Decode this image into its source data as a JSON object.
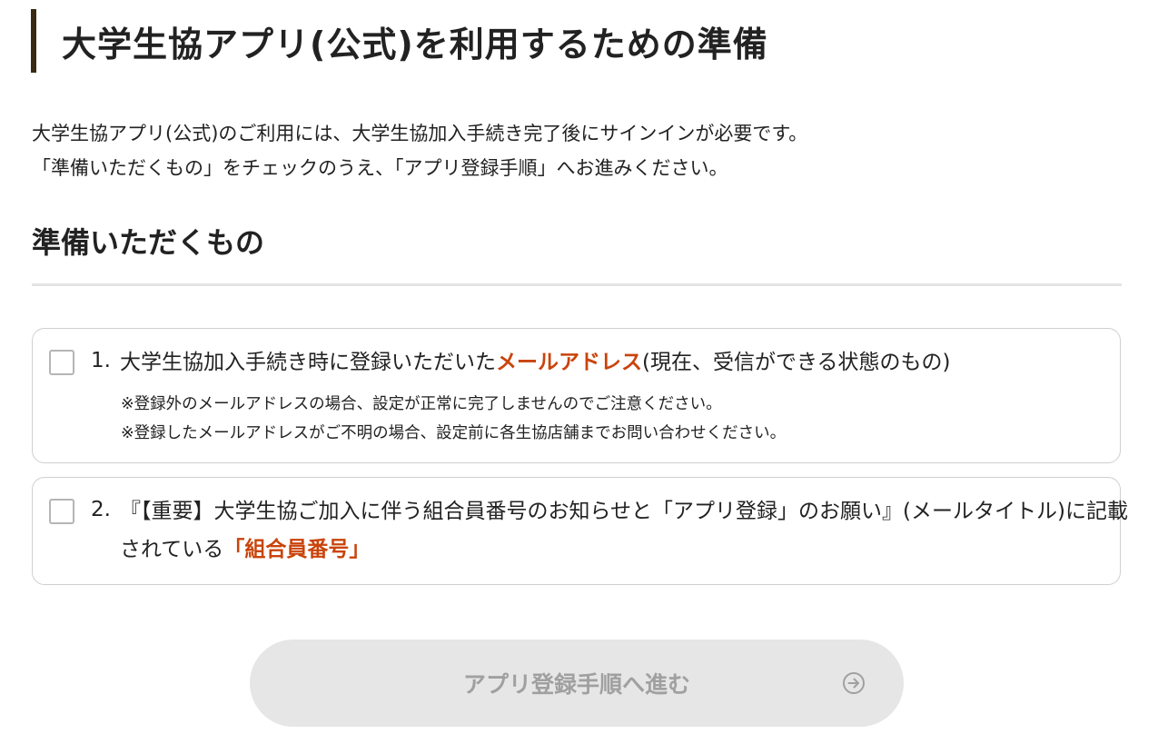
{
  "header": {
    "title": "大学生協アプリ(公式)を利用するための準備"
  },
  "intro": {
    "line1": "大学生協アプリ(公式)のご利用には、大学生協加入手続き完了後にサインインが必要です。",
    "line2": "「準備いただくもの」をチェックのうえ、「アプリ登録手順」へお進みください。"
  },
  "section": {
    "title": "準備いただくもの"
  },
  "items": [
    {
      "number": "1.",
      "text_before": "大学生協加入手続き時に登録いただいた",
      "highlight": "メールアドレス",
      "text_after": "(現在、受信ができる状態のもの)",
      "notes": [
        "※登録外のメールアドレスの場合、設定が正常に完了しませんのでご注意ください。",
        "※登録したメールアドレスがご不明の場合、設定前に各生協店舗までお問い合わせください。"
      ],
      "checked": false
    },
    {
      "number": "2.",
      "text_line1": "『【重要】大学生協ご加入に伴う組合員番号のお知らせと「アプリ登録」のお願い』(メールタイトル)に記載",
      "text_line2_before": "されている",
      "highlight": "「組合員番号」",
      "checked": false
    }
  ],
  "submit": {
    "label": "アプリ登録手順へ進む",
    "icon": "arrow-right-circle-icon",
    "enabled": false
  },
  "colors": {
    "accent": "#c9440b",
    "title_bar": "#3a2a14",
    "button_disabled_bg": "#e6e6e6",
    "button_disabled_text": "#a0a0a0"
  }
}
